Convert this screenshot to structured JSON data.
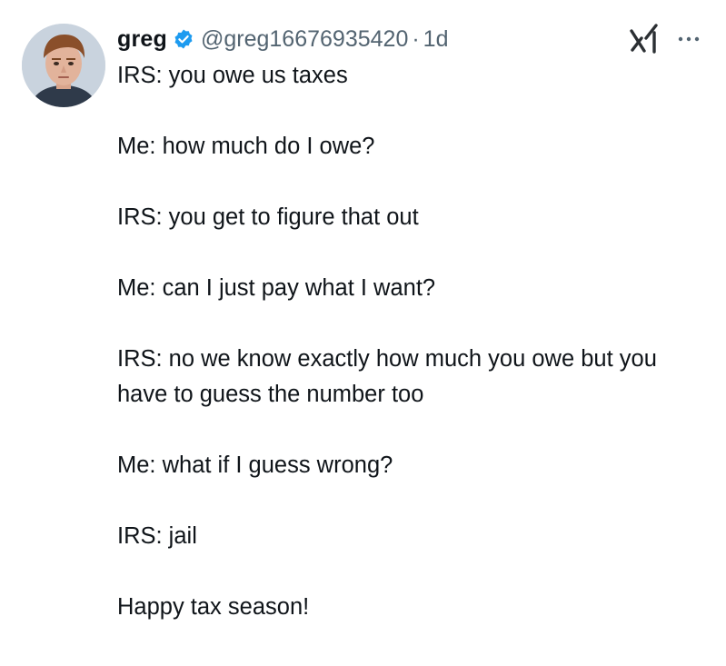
{
  "tweet": {
    "author": {
      "display_name": "greg",
      "handle": "@greg16676935420",
      "verified": true,
      "verified_color": "#1d9bf0"
    },
    "separator": "·",
    "timestamp": "1d",
    "icons": {
      "avatar": "profile-photo",
      "verified": "verified-badge-icon",
      "grok": "grok-icon",
      "more": "more-options-icon"
    },
    "paragraphs": [
      "IRS: you owe us taxes",
      "Me: how much do I owe?",
      "IRS: you get to figure that out",
      "Me: can I just pay what I want?",
      "IRS: no we know exactly how much you owe but you have to guess the number too",
      "Me: what if I guess wrong?",
      "IRS: jail",
      "Happy tax season!"
    ]
  },
  "colors": {
    "text_primary": "#0f1419",
    "text_secondary": "#536471",
    "background": "#ffffff"
  }
}
